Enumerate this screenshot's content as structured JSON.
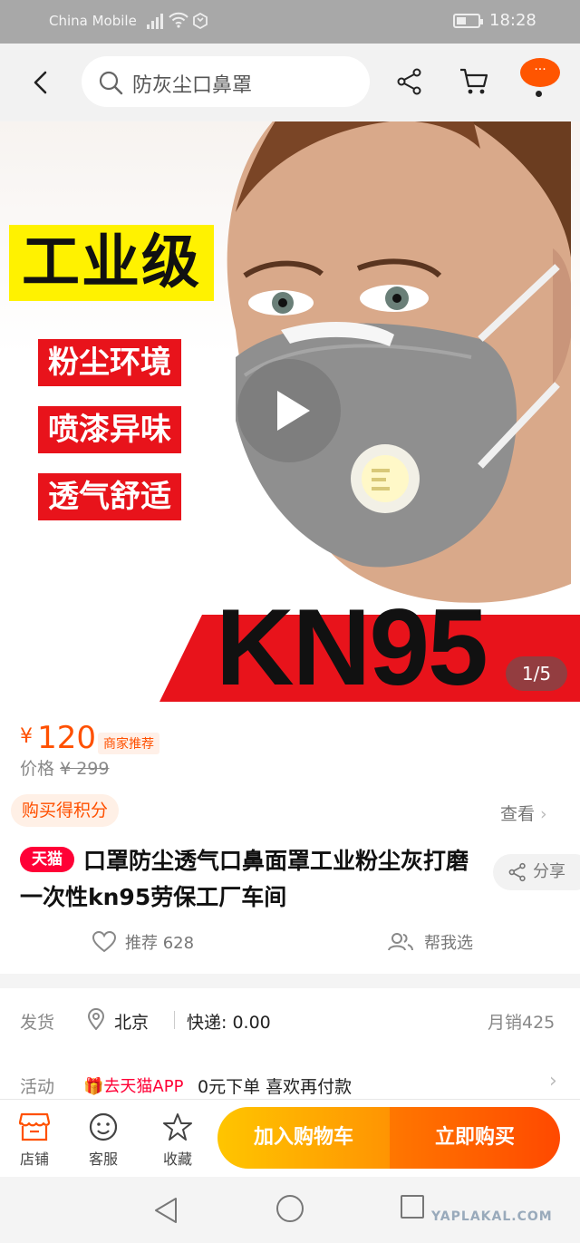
{
  "status_bar": {
    "carrier": "China Mobile",
    "time": "18:28"
  },
  "header": {
    "search_placeholder": "防灰尘口鼻罩",
    "more_label": "···"
  },
  "hero": {
    "headline": "工业级",
    "tags": [
      "粉尘环境",
      "喷漆异味",
      "透气舒适"
    ],
    "model": "KN95",
    "mask_print": "PM2.5",
    "pager": "1/5"
  },
  "price": {
    "currency": "¥",
    "value": "120",
    "badge": "商家推荐",
    "original_label": "价格",
    "original_value": "¥ 299"
  },
  "points": {
    "label": "购买得积分",
    "view_label": "查看",
    "chevron": "›"
  },
  "product": {
    "store_badge": "天猫",
    "title": "口罩防尘透气口鼻面罩工业粉尘灰打磨一次性kn95劳保工厂车间",
    "share_label": "分享"
  },
  "social": {
    "recommend_label": "推荐 628",
    "help_label": "帮我选"
  },
  "shipping": {
    "label": "发货",
    "city": "北京",
    "express": "快递: 0.00",
    "monthly_sales": "月销425"
  },
  "promotion": {
    "label": "活动",
    "app_tag": "🎁去天猫APP",
    "text": "0元下单 喜欢再付款",
    "chevron": "›"
  },
  "bottom_bar": {
    "store": "店铺",
    "service": "客服",
    "favorite": "收藏",
    "add_to_cart": "加入购物车",
    "buy_now": "立即购买"
  },
  "nav": {
    "watermark": "YAPLAKAL.COM"
  },
  "colors": {
    "accent": "#ff5000",
    "tmall_red": "#ff0036",
    "cart_button": "#ffb000",
    "buy_button": "#ff5500"
  }
}
